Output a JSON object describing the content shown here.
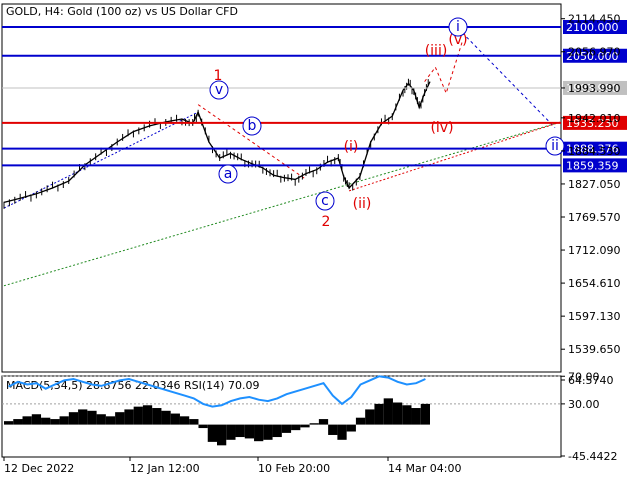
{
  "header": {
    "symbol_title": "GOLD, H4:  Gold (100 oz) vs US Dollar CFD"
  },
  "indicator": {
    "label": "MACD(5,34,5) 28.8756 22.0346 RSI(14) 70.09"
  },
  "colors": {
    "background": "#ffffff",
    "price_line": "#000000",
    "level_blue": "#0000cd",
    "level_red": "#e00000",
    "label_blue_bg": "#0000cd",
    "label_red_bg": "#e00000",
    "current_price_bg": "#c0c0c0",
    "rsi_line": "#1e90ff",
    "macd_hist": "#000000",
    "wave_red": "#e00000",
    "wave_blue": "#0000cd",
    "trend_green": "#228b22"
  },
  "chart_data": {
    "type": "line",
    "title": "GOLD, H4:  Gold (100 oz) vs US Dollar CFD",
    "price_axis": {
      "ticks": [
        "2114.450",
        "2056.970",
        "1993.990",
        "1942.010",
        "1884.530",
        "1827.050",
        "1769.570",
        "1712.090",
        "1654.610",
        "1597.130",
        "1539.650"
      ],
      "ylim": [
        1500,
        2140
      ]
    },
    "time_axis": {
      "ticks": [
        "12 Dec 2022",
        "12 Jan 12:00",
        "10 Feb 20:00",
        "14 Mar 04:00"
      ],
      "xlim": [
        0,
        100
      ]
    },
    "horizontal_levels": [
      {
        "value": "2100.000",
        "price": 2100.0,
        "color": "blue"
      },
      {
        "value": "2050.000",
        "price": 2050.0,
        "color": "blue"
      },
      {
        "value": "1933.230",
        "price": 1933.23,
        "color": "red"
      },
      {
        "value": "1888.376",
        "price": 1888.376,
        "color": "blue"
      },
      {
        "value": "1859.359",
        "price": 1859.359,
        "color": "blue"
      }
    ],
    "current_price": {
      "value": "1993.990",
      "price": 1993.99
    },
    "series": [
      {
        "values": [
          [
            0,
            1795
          ],
          [
            3,
            1802
          ],
          [
            6,
            1810
          ],
          [
            9,
            1820
          ],
          [
            12,
            1832
          ],
          [
            15,
            1860
          ],
          [
            18,
            1880
          ],
          [
            21,
            1900
          ],
          [
            24,
            1918
          ],
          [
            27,
            1928
          ],
          [
            30,
            1935
          ],
          [
            33,
            1940
          ],
          [
            35,
            1932
          ],
          [
            36,
            1952
          ],
          [
            38,
            1900
          ],
          [
            40,
            1872
          ],
          [
            42,
            1880
          ],
          [
            44,
            1870
          ],
          [
            46,
            1862
          ],
          [
            48,
            1855
          ],
          [
            50,
            1842
          ],
          [
            52,
            1838
          ],
          [
            54,
            1835
          ],
          [
            56,
            1845
          ],
          [
            58,
            1852
          ],
          [
            60,
            1865
          ],
          [
            62,
            1872
          ],
          [
            63,
            1840
          ],
          [
            64,
            1820
          ],
          [
            66,
            1840
          ],
          [
            68,
            1900
          ],
          [
            70,
            1932
          ],
          [
            72,
            1945
          ],
          [
            74,
            1990
          ],
          [
            75,
            2002
          ],
          [
            76,
            1990
          ],
          [
            77,
            1960
          ],
          [
            78,
            1985
          ],
          [
            79,
            2005
          ]
        ]
      }
    ],
    "wave_labels": [
      {
        "text": "1",
        "color": "red",
        "circled": false
      },
      {
        "text": "2",
        "color": "red",
        "circled": false
      },
      {
        "text": "v",
        "color": "blue",
        "circled": true
      },
      {
        "text": "a",
        "color": "blue",
        "circled": true
      },
      {
        "text": "b",
        "color": "blue",
        "circled": true
      },
      {
        "text": "c",
        "color": "blue",
        "circled": true
      },
      {
        "text": "(i)",
        "color": "red",
        "circled": false
      },
      {
        "text": "(ii)",
        "color": "red",
        "circled": false
      },
      {
        "text": "(iii)",
        "color": "red",
        "circled": false
      },
      {
        "text": "(iv)",
        "color": "red",
        "circled": false
      },
      {
        "text": "(v)",
        "color": "red",
        "circled": false
      },
      {
        "text": "i",
        "color": "blue",
        "circled": true
      },
      {
        "text": "ii",
        "color": "blue",
        "circled": true
      }
    ],
    "indicator_axis": {
      "ticks": [
        "64.5740",
        "70.00",
        "30.00",
        "-45.4422"
      ]
    },
    "indicator_series": [
      {
        "name": "MACD",
        "values": [
          5,
          8,
          12,
          15,
          10,
          8,
          12,
          18,
          22,
          20,
          15,
          12,
          18,
          22,
          26,
          28,
          24,
          20,
          16,
          12,
          8,
          -5,
          -25,
          -30,
          -22,
          -18,
          -20,
          -24,
          -22,
          -18,
          -12,
          -8,
          -4,
          2,
          8,
          -15,
          -22,
          -10,
          10,
          22,
          30,
          38,
          32,
          28,
          24,
          30
        ]
      },
      {
        "name": "RSI",
        "values": [
          55,
          62,
          58,
          60,
          52,
          58,
          64,
          66,
          62,
          58,
          56,
          60,
          64,
          66,
          62,
          58,
          54,
          50,
          46,
          42,
          38,
          30,
          26,
          28,
          34,
          38,
          40,
          36,
          34,
          38,
          44,
          48,
          52,
          56,
          60,
          42,
          30,
          40,
          58,
          64,
          70,
          68,
          62,
          58,
          60,
          66
        ]
      }
    ]
  }
}
